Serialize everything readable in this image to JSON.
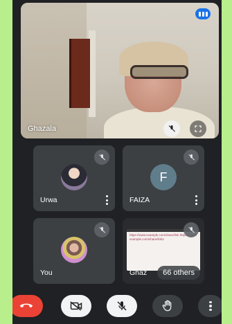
{
  "main_participant": {
    "name": "Ghazala"
  },
  "tiles": [
    {
      "name": "Urwa",
      "avatar": "photo"
    },
    {
      "name": "FAIZA",
      "avatar_letter": "F"
    },
    {
      "name": "You",
      "avatar": "photo"
    },
    {
      "name": "Ghaz",
      "overflow_label": "66 others"
    }
  ],
  "presentation_preview_text": "https://www.example.com/share/link https://www.example.com/share/link2",
  "controls": {
    "end_call": "end-call",
    "camera": "camera-off",
    "microphone": "mic-off",
    "raise_hand": "raise-hand",
    "more": "more-options"
  },
  "colors": {
    "end_call": "#ea4335",
    "cast": "#1a73e8",
    "frame": "#b9ee8c"
  }
}
